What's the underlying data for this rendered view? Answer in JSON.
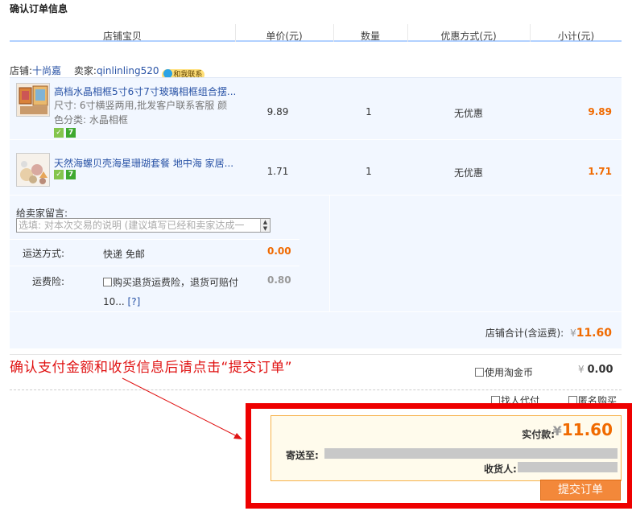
{
  "page_title": "确认订单信息",
  "table_headers": {
    "product": "店铺宝贝",
    "unit_price": "单价(元)",
    "quantity": "数量",
    "discount": "优惠方式(元)",
    "subtotal": "小计(元)"
  },
  "shop": {
    "shop_label": "店铺:",
    "shop_name": "十尚嘉",
    "seller_label": "卖家:",
    "seller_name": "qinlinling520",
    "contact_label": "和我联系"
  },
  "items": [
    {
      "name": "高档水晶相框5寸6寸7寸玻璃相框组合摆...",
      "attr1": "尺寸: 6寸横竖两用,批发客户联系客服  颜",
      "attr2": "色分类: 水晶相框",
      "badge1": "✓",
      "badge2": "7",
      "price": "9.89",
      "qty": "1",
      "discount": "无优惠",
      "subtotal": "9.89"
    },
    {
      "name": "天然海螺贝壳海星珊瑚套餐 地中海 家居...",
      "badge1": "✓",
      "badge2": "7",
      "price": "1.71",
      "qty": "1",
      "discount": "无优惠",
      "subtotal": "1.71"
    }
  ],
  "message": {
    "label": "给卖家留言:",
    "placeholder": "选填: 对本次交易的说明 (建议填写已经和卖家达成一"
  },
  "shipping": {
    "label": "运送方式:",
    "method": "快递 免邮",
    "cost": "0.00"
  },
  "insurance": {
    "label": "运费险:",
    "text_line1": "购买退货运费险，退货可赔付",
    "text_line2": "10...",
    "help": "[?]",
    "cost": "0.80"
  },
  "shop_total": {
    "label": "店铺合计(含运费):",
    "currency": "¥",
    "value": "11.60"
  },
  "instruction": "确认支付金额和收货信息后请点击“提交订单”",
  "taojinbi": {
    "label": "使用淘金币",
    "currency": "¥",
    "value": "0.00"
  },
  "options": {
    "pay_for_me": "找人代付",
    "anonymous": "匿名购买"
  },
  "payment": {
    "label": "实付款:",
    "currency": "¥",
    "value": "11.60",
    "ship_to_label": "寄送至:",
    "receiver_label": "收货人:"
  },
  "submit_label": "提交订单",
  "colors": {
    "accent_orange": "#f06a00",
    "link_blue": "#2953a6",
    "highlight_red": "#ee0000",
    "submit_bg": "#f3883a"
  }
}
